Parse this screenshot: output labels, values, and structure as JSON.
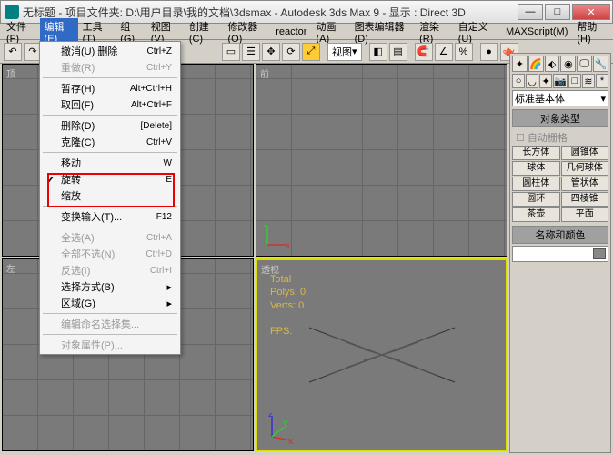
{
  "title": "无标题 - 项目文件夹: D:\\用户目录\\我的文档\\3dsmax - Autodesk 3ds Max 9    - 显示 : Direct 3D",
  "menubar": [
    "文件(F)",
    "编辑(E)",
    "工具(T)",
    "组(G)",
    "视图(V)",
    "创建(C)",
    "修改器(O)",
    "reactor",
    "动画(A)",
    "图表编辑器(D)",
    "渲染(R)",
    "自定义(U)",
    "MAXScript(M)",
    "帮助(H)"
  ],
  "viewdrop": "视图",
  "viewports": {
    "tl": "顶",
    "tr": "前",
    "bl": "左",
    "br": "透视"
  },
  "stats": {
    "l1": "Total",
    "l2": "Polys: 0",
    "l3": "Verts: 0",
    "l4": "FPS:"
  },
  "panel": {
    "category": "标准基本体",
    "roll1": "对象类型",
    "autogrid": "自动栅格",
    "prims": [
      "长方体",
      "圆锥体",
      "球体",
      "几何球体",
      "圆柱体",
      "管状体",
      "圆环",
      "四棱锥",
      "茶壶",
      "平面"
    ],
    "roll2": "名称和颜色"
  },
  "menu": {
    "undo": {
      "l": "撤消(U) 删除",
      "s": "Ctrl+Z"
    },
    "redo": {
      "l": "重做(R)",
      "s": "Ctrl+Y"
    },
    "hold": {
      "l": "暂存(H)",
      "s": "Alt+Ctrl+H"
    },
    "fetch": {
      "l": "取回(F)",
      "s": "Alt+Ctrl+F"
    },
    "delete": {
      "l": "删除(D)",
      "s": "[Delete]"
    },
    "clone": {
      "l": "克隆(C)",
      "s": "Ctrl+V"
    },
    "move": {
      "l": "移动",
      "s": "W"
    },
    "rotate": {
      "l": "旋转",
      "s": "E"
    },
    "scale": {
      "l": "缩放",
      "s": ""
    },
    "xform": {
      "l": "变换输入(T)...",
      "s": "F12"
    },
    "selall": {
      "l": "全选(A)",
      "s": "Ctrl+A"
    },
    "selnone": {
      "l": "全部不选(N)",
      "s": "Ctrl+D"
    },
    "selinv": {
      "l": "反选(I)",
      "s": "Ctrl+I"
    },
    "selby": {
      "l": "选择方式(B)"
    },
    "region": {
      "l": "区域(G)"
    },
    "editnamed": {
      "l": "编辑命名选择集..."
    },
    "props": {
      "l": "对象属性(P)..."
    }
  }
}
